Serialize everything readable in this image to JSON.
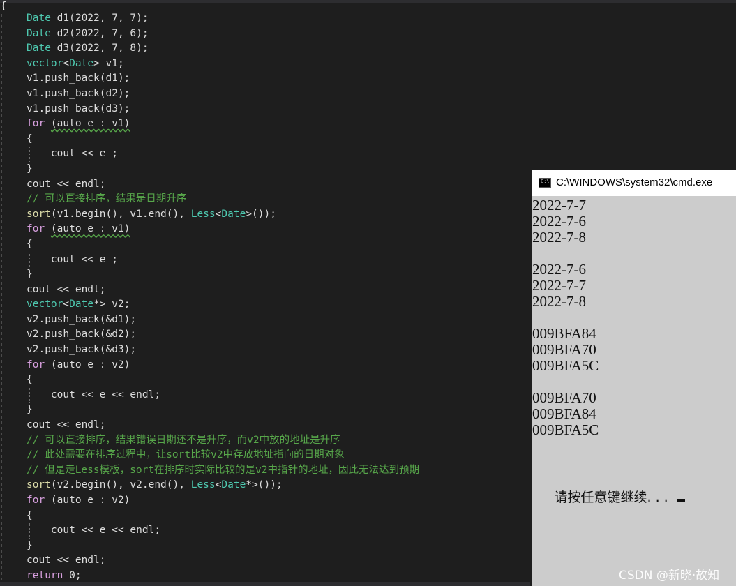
{
  "editor": {
    "open_brace": "{",
    "lines": [
      {
        "segs": [
          {
            "t": "Date ",
            "c": "#4ec9b0"
          },
          {
            "t": "d1(2022, 7, 7);",
            "c": "#dcdcdc"
          }
        ]
      },
      {
        "segs": [
          {
            "t": "Date ",
            "c": "#4ec9b0"
          },
          {
            "t": "d2(2022, 7, 6);",
            "c": "#dcdcdc"
          }
        ]
      },
      {
        "segs": [
          {
            "t": "Date ",
            "c": "#4ec9b0"
          },
          {
            "t": "d3(2022, 7, 8);",
            "c": "#dcdcdc"
          }
        ]
      },
      {
        "segs": [
          {
            "t": "vector",
            "c": "#4ec9b0"
          },
          {
            "t": "<",
            "c": "#dcdcdc"
          },
          {
            "t": "Date",
            "c": "#4ec9b0"
          },
          {
            "t": "> v1;",
            "c": "#dcdcdc"
          }
        ]
      },
      {
        "segs": [
          {
            "t": "v1.push_back(d1);",
            "c": "#dcdcdc"
          }
        ]
      },
      {
        "segs": [
          {
            "t": "v1.push_back(d2);",
            "c": "#dcdcdc"
          }
        ]
      },
      {
        "segs": [
          {
            "t": "v1.push_back(d3);",
            "c": "#dcdcdc"
          }
        ]
      },
      {
        "segs": [
          {
            "t": "for ",
            "c": "#d8a0df"
          },
          {
            "t": "(auto e : v1)",
            "c": "#dcdcdc",
            "squiggle": true
          }
        ]
      },
      {
        "segs": [
          {
            "t": "{",
            "c": "#dcdcdc"
          }
        ]
      },
      {
        "segs": [
          {
            "t": "    cout << e ;",
            "c": "#dcdcdc"
          }
        ],
        "guide": true
      },
      {
        "segs": [
          {
            "t": "}",
            "c": "#dcdcdc"
          }
        ]
      },
      {
        "segs": [
          {
            "t": "cout << endl;",
            "c": "#dcdcdc"
          }
        ]
      },
      {
        "segs": [
          {
            "t": "// 可以直接排序，结果是日期升序",
            "c": "#57a64a"
          }
        ]
      },
      {
        "segs": [
          {
            "t": "sort",
            "c": "#dcdcaa"
          },
          {
            "t": "(v1.begin(), v1.end(), ",
            "c": "#dcdcdc"
          },
          {
            "t": "Less",
            "c": "#4ec9b0"
          },
          {
            "t": "<",
            "c": "#dcdcdc"
          },
          {
            "t": "Date",
            "c": "#4ec9b0"
          },
          {
            "t": ">());",
            "c": "#dcdcdc"
          }
        ]
      },
      {
        "segs": [
          {
            "t": "for ",
            "c": "#d8a0df"
          },
          {
            "t": "(auto e : v1)",
            "c": "#dcdcdc",
            "squiggle": true
          }
        ]
      },
      {
        "segs": [
          {
            "t": "{",
            "c": "#dcdcdc"
          }
        ]
      },
      {
        "segs": [
          {
            "t": "    cout << e ;",
            "c": "#dcdcdc"
          }
        ],
        "guide": true
      },
      {
        "segs": [
          {
            "t": "}",
            "c": "#dcdcdc"
          }
        ]
      },
      {
        "segs": [
          {
            "t": "cout << endl;",
            "c": "#dcdcdc"
          }
        ]
      },
      {
        "segs": [
          {
            "t": "vector",
            "c": "#4ec9b0"
          },
          {
            "t": "<",
            "c": "#dcdcdc"
          },
          {
            "t": "Date",
            "c": "#4ec9b0"
          },
          {
            "t": "*> v2;",
            "c": "#dcdcdc"
          }
        ]
      },
      {
        "segs": [
          {
            "t": "v2.push_back(&d1);",
            "c": "#dcdcdc"
          }
        ]
      },
      {
        "segs": [
          {
            "t": "v2.push_back(&d2);",
            "c": "#dcdcdc"
          }
        ]
      },
      {
        "segs": [
          {
            "t": "v2.push_back(&d3);",
            "c": "#dcdcdc"
          }
        ]
      },
      {
        "segs": [
          {
            "t": "for ",
            "c": "#d8a0df"
          },
          {
            "t": "(auto e : v2)",
            "c": "#dcdcdc"
          }
        ]
      },
      {
        "segs": [
          {
            "t": "{",
            "c": "#dcdcdc"
          }
        ]
      },
      {
        "segs": [
          {
            "t": "    cout << e << endl;",
            "c": "#dcdcdc"
          }
        ],
        "guide": true
      },
      {
        "segs": [
          {
            "t": "}",
            "c": "#dcdcdc"
          }
        ]
      },
      {
        "segs": [
          {
            "t": "cout << endl;",
            "c": "#dcdcdc"
          }
        ]
      },
      {
        "segs": [
          {
            "t": "// 可以直接排序，结果错误日期还不是升序，而v2中放的地址是升序",
            "c": "#57a64a"
          }
        ]
      },
      {
        "segs": [
          {
            "t": "// 此处需要在排序过程中，让sort比较v2中存放地址指向的日期对象",
            "c": "#57a64a"
          }
        ]
      },
      {
        "segs": [
          {
            "t": "// 但是走Less模板，sort在排序时实际比较的是v2中指针的地址，因此无法达到预期",
            "c": "#57a64a"
          }
        ]
      },
      {
        "segs": [
          {
            "t": "sort",
            "c": "#dcdcaa"
          },
          {
            "t": "(v2.begin(), v2.end(), ",
            "c": "#dcdcdc"
          },
          {
            "t": "Less",
            "c": "#4ec9b0"
          },
          {
            "t": "<",
            "c": "#dcdcdc"
          },
          {
            "t": "Date",
            "c": "#4ec9b0"
          },
          {
            "t": "*>());",
            "c": "#dcdcdc"
          }
        ]
      },
      {
        "segs": [
          {
            "t": "for ",
            "c": "#d8a0df"
          },
          {
            "t": "(auto e : v2)",
            "c": "#dcdcdc"
          }
        ]
      },
      {
        "segs": [
          {
            "t": "{",
            "c": "#dcdcdc"
          }
        ]
      },
      {
        "segs": [
          {
            "t": "    cout << e << endl;",
            "c": "#dcdcdc"
          }
        ],
        "guide": true
      },
      {
        "segs": [
          {
            "t": "}",
            "c": "#dcdcdc"
          }
        ]
      },
      {
        "segs": [
          {
            "t": "cout << endl;",
            "c": "#dcdcdc"
          }
        ]
      },
      {
        "segs": [
          {
            "t": "return ",
            "c": "#d8a0df"
          },
          {
            "t": "0;",
            "c": "#dcdcdc"
          }
        ]
      }
    ]
  },
  "console": {
    "title": "C:\\WINDOWS\\system32\\cmd.exe",
    "icon": "cmd-icon",
    "lines": [
      "2022-7-7",
      "2022-7-6",
      "2022-7-8",
      "",
      "2022-7-6",
      "2022-7-7",
      "2022-7-8",
      "",
      "009BFA84",
      "009BFA70",
      "009BFA5C",
      "",
      "009BFA70",
      "009BFA84",
      "009BFA5C",
      "",
      ""
    ],
    "prompt": "请按任意键继续. . . "
  },
  "watermark": "CSDN @新晓·故知"
}
